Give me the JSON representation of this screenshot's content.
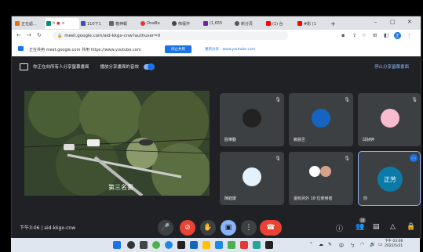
{
  "browser": {
    "tabs": [
      {
        "label": "正在處..."
      },
      {
        "label": "h",
        "active": true
      },
      {
        "label": "110下1"
      },
      {
        "label": "箱神報"
      },
      {
        "label": "OneBo"
      },
      {
        "label": "佈壇作"
      },
      {
        "label": "(1,655"
      },
      {
        "label": "新分頁"
      },
      {
        "label": "(1) 台"
      },
      {
        "label": "#影 (1"
      }
    ],
    "new_tab": "+",
    "win_min": "–",
    "win_max": "□",
    "win_close": "✕",
    "url": "meet.google.com/aid-kkgx-cnw?authuser=0",
    "profile_letter": "正"
  },
  "share_bar": {
    "text": "正在共用 meet.google.com 共用 https://www.youtube.com",
    "stop_button": "停止共用",
    "switch_link": "重新分享：www.youtube.com"
  },
  "meet": {
    "presenting_text": "你正在向所有人分享螢幕畫面",
    "audio_label": "播放分享畫面的音效",
    "stop_presenting": "停止分享螢幕畫面",
    "video_caption": "第三名書",
    "participants": [
      {
        "name": "歐樂動"
      },
      {
        "name": "賴晨丞"
      },
      {
        "name": "邱昶婷"
      },
      {
        "name": "陳鈺媛"
      },
      {
        "name": "還有另外 18 位使用者"
      },
      {
        "name": "你",
        "avatar_text": "正芳"
      }
    ],
    "meeting_info": "下午3:06 | aid-kkgx-cnw",
    "participant_count": "24"
  },
  "taskbar": {
    "tray_text": "中",
    "time": "下午 03:06",
    "date": "2022/5/31"
  },
  "colors": {
    "accent": "#1a73e8",
    "meet_bg": "#202124",
    "tile_bg": "#3c4043",
    "hangup": "#ea4335"
  }
}
